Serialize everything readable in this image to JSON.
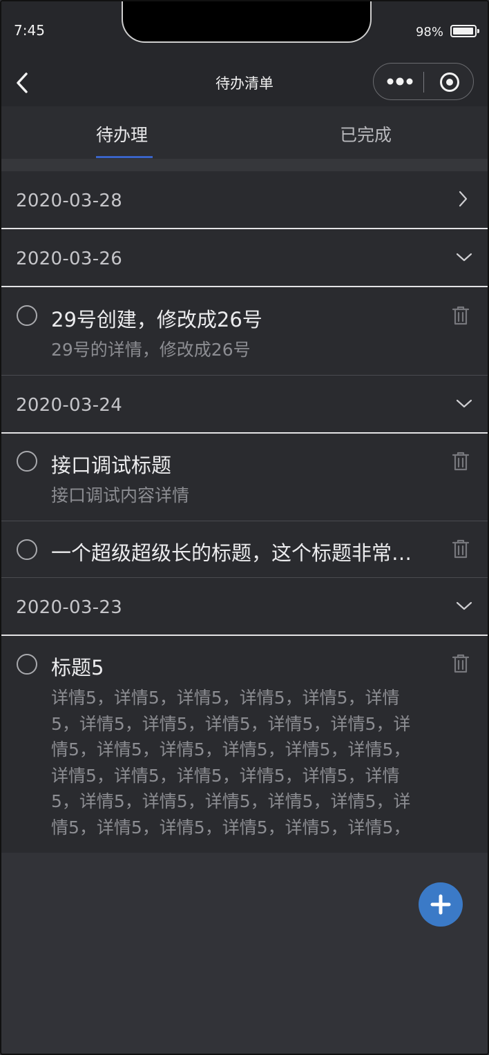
{
  "status": {
    "time": "7:45",
    "battery": "98%"
  },
  "nav": {
    "title": "待办清单",
    "back_icon": "chevron-left-icon",
    "more_icon": "more-dots-icon",
    "close_icon": "target-icon"
  },
  "tabs": [
    {
      "label": "待办理",
      "active": true
    },
    {
      "label": "已完成",
      "active": false
    }
  ],
  "groups": [
    {
      "date": "2020-03-28",
      "expanded": false,
      "items": []
    },
    {
      "date": "2020-03-26",
      "expanded": true,
      "items": [
        {
          "title": "29号创建，修改成26号",
          "detail": "29号的详情，修改成26号"
        }
      ]
    },
    {
      "date": "2020-03-24",
      "expanded": true,
      "items": [
        {
          "title": "接口调试标题",
          "detail": "接口调试内容详情"
        },
        {
          "title": "一个超级超级长的标题，这个标题非常…",
          "detail": ""
        }
      ]
    },
    {
      "date": "2020-03-23",
      "expanded": true,
      "items": [
        {
          "title": "标题5",
          "detail_lines": [
            "详情5，详情5，详情5，详情5，详情5，详情",
            "5，详情5，详情5，详情5，详情5，详情5，详",
            "情5，详情5，详情5，详情5，详情5，详情5，",
            "详情5，详情5，详情5，详情5，详情5，详情",
            "5，详情5，详情5，详情5，详情5，详情5，详",
            "情5，详情5，详情5，详情5，详情5，详情5，"
          ]
        }
      ]
    }
  ],
  "fab": {
    "icon": "plus-icon"
  },
  "colors": {
    "accent": "#3b7ac7",
    "tab_underline": "#3a64c8",
    "background": "#323338"
  }
}
